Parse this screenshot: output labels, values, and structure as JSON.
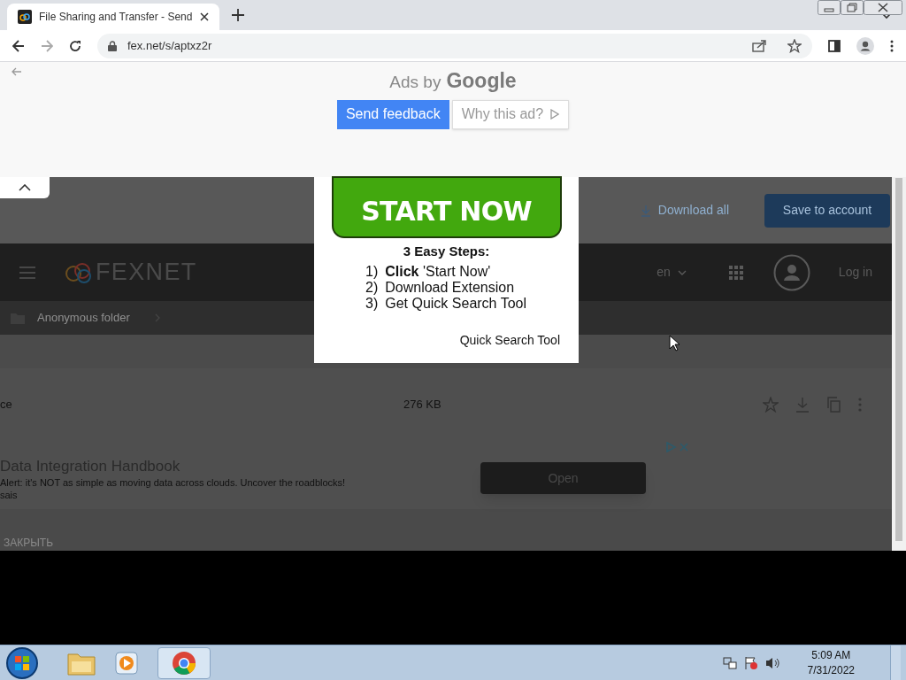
{
  "browser": {
    "tab_title": "File Sharing and Transfer - Send",
    "url": "fex.net/s/aptxz2r"
  },
  "ad_banner": {
    "label": "Ads by",
    "brand": "Google",
    "buttons": [
      "Send feedback",
      "Why this ad?"
    ]
  },
  "page": {
    "actions": [
      "Download all",
      "Save to account"
    ],
    "logo": "FEXNET",
    "language": "en",
    "login": "Log in",
    "breadcrumb": "Anonymous folder",
    "file": {
      "name": "ce",
      "size": "276 KB"
    },
    "ad": {
      "title": "Data Integration Handbook",
      "text": "Alert: it's NOT as simple as moving data across clouds. Uncover the roadblocks!",
      "text_2": "sais",
      "button": "Open"
    },
    "close_label": "ЗАКРЫТЬ"
  },
  "popup": {
    "button": "START NOW",
    "heading": "3 Easy Steps:",
    "steps": [
      {
        "number": "1)",
        "text": "**Click** 'Start Now'"
      },
      {
        "number": "2)",
        "text": "Download Extension"
      },
      {
        "number": "3)",
        "text": "Get Quick Search Tool"
      }
    ],
    "footer": "Quick Search Tool"
  },
  "taskbar": {
    "time": "5:09 AM",
    "date": "7/31/2022"
  }
}
